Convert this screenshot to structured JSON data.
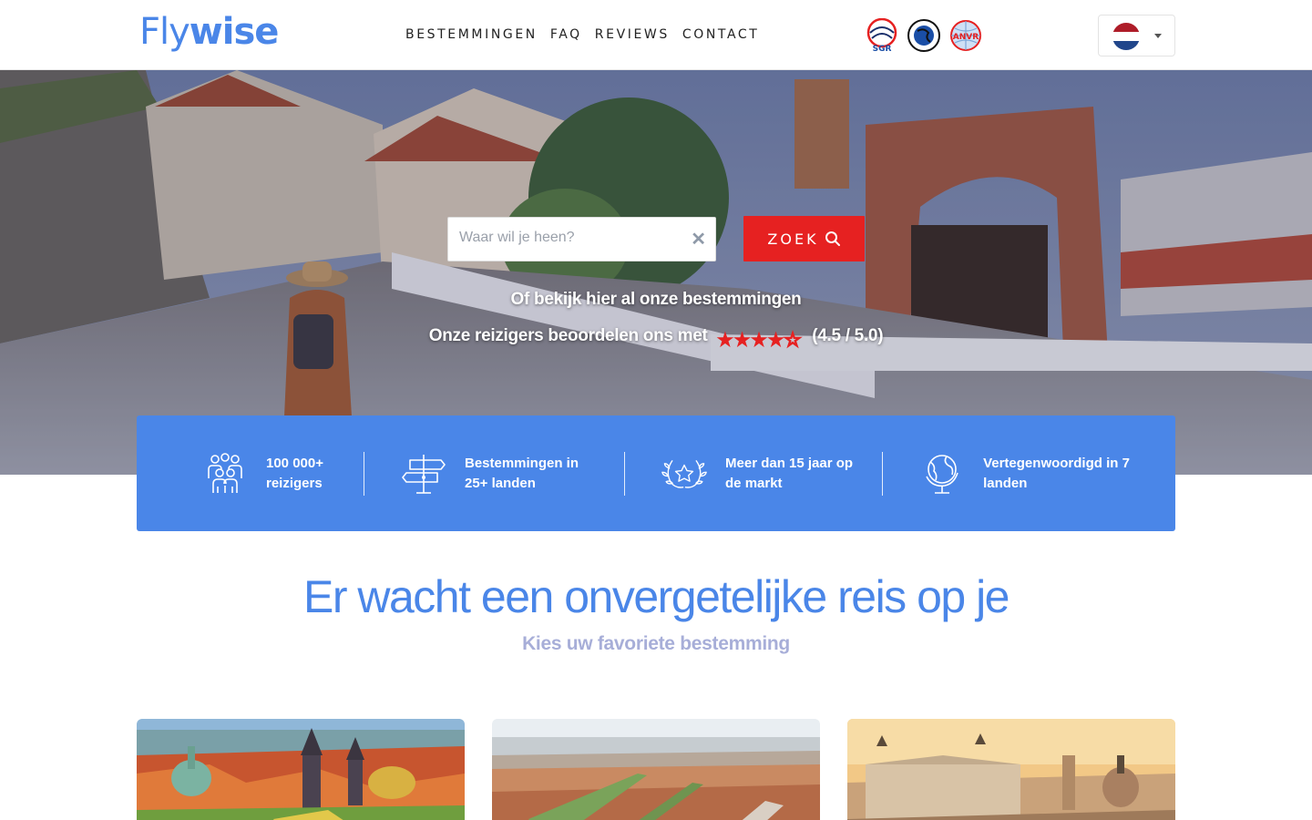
{
  "header": {
    "logo": {
      "part1": "Fly",
      "part2": "wise"
    },
    "nav": [
      "BESTEMMINGEN",
      "FAQ",
      "REVIEWS",
      "CONTACT"
    ],
    "partners": [
      {
        "name": "SGR",
        "color": "#e62121"
      },
      {
        "name": "Calamiteitenfonds",
        "color": "#1a2f6b"
      },
      {
        "name": "ANVR",
        "color": "#e62121"
      }
    ],
    "language": {
      "selected": "nl",
      "flag_colors": [
        "#ae1c28",
        "#ffffff",
        "#21468b"
      ]
    }
  },
  "hero": {
    "search_placeholder": "Waar wil je heen?",
    "search_value": "",
    "search_button": "ZOEK",
    "all_destinations_link": "Of bekijk hier al onze bestemmingen",
    "rating_text": "Onze reizigers beoordelen ons met",
    "rating_value": 4.5,
    "rating_max": 5,
    "rating_label": "(4.5 / 5.0)"
  },
  "stats": [
    {
      "icon": "people-group-icon",
      "line1": "100 000+",
      "line2": "reizigers"
    },
    {
      "icon": "signpost-icon",
      "line1": "Bestemmingen in",
      "line2": "25+ landen"
    },
    {
      "icon": "laurel-star-icon",
      "line1": "Meer dan 15 jaar op",
      "line2": "de markt"
    },
    {
      "icon": "globe-icon",
      "line1": "Vertegenwoordigd in 7",
      "line2": "landen"
    }
  ],
  "section": {
    "title": "Er wacht een onvergetelijke reis op je",
    "subtitle": "Kies uw favoriete bestemming"
  },
  "colors": {
    "brand_blue": "#4a86e8",
    "cta_red": "#e62121",
    "subtitle_lilac": "#a7aed8"
  },
  "cards": [
    {
      "image": "prague-cityscape"
    },
    {
      "image": "city-aerial-view"
    },
    {
      "image": "rome-monument"
    }
  ]
}
